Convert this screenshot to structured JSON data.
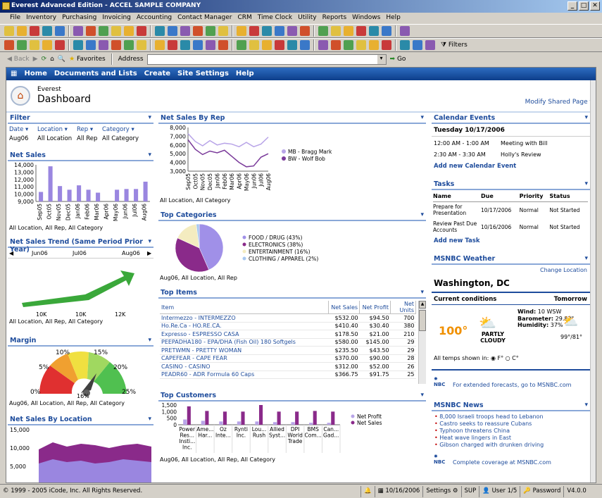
{
  "window": {
    "title": "Everest Advanced Edition - ACCEL SAMPLE COMPANY",
    "controls": [
      "_",
      "□",
      "✕"
    ]
  },
  "menu": [
    "File",
    "Inventory",
    "Purchasing",
    "Invoicing",
    "Accounting",
    "Contact Manager",
    "CRM",
    "Time Clock",
    "Utility",
    "Reports",
    "Windows",
    "Help"
  ],
  "nav": {
    "back": "Back",
    "favorites": "Favorites",
    "address_label": "Address",
    "go": "Go",
    "filters": "Filters"
  },
  "sp_nav": [
    "Home",
    "Documents and Lists",
    "Create",
    "Site Settings",
    "Help"
  ],
  "header": {
    "site": "Everest",
    "title": "Dashboard",
    "modify": "Modify Shared Page ▾"
  },
  "filter": {
    "title": "Filter",
    "cols": [
      "Date",
      "Location",
      "Rep",
      "Category"
    ],
    "vals": [
      "Aug06",
      "All Location",
      "All Rep",
      "All Category"
    ]
  },
  "net_sales": {
    "title": "Net Sales",
    "footer": "All Location, All Rep, All Category"
  },
  "net_sales_trend": {
    "title": "Net Sales Trend (Same Period Prior Year)",
    "months": [
      "Jun06",
      "Jul06",
      "Aug06"
    ],
    "ticks": [
      "10K",
      "10K",
      "12K"
    ],
    "footer": "All Location, All Rep, All Category"
  },
  "margin": {
    "title": "Margin",
    "labels": [
      "0%",
      "5%",
      "10%",
      "15%",
      "20%",
      "25%"
    ],
    "value": "16%",
    "footer": "Aug06, All Location, All Rep, All Category"
  },
  "net_sales_by_location": {
    "title": "Net Sales By Location",
    "yticks": [
      "15,000",
      "10,000",
      "5,000"
    ]
  },
  "net_sales_by_rep": {
    "title": "Net Sales By Rep",
    "legend": [
      "MB - Bragg Mark",
      "BW - Wolf Bob"
    ],
    "footer": "All Location, All Category"
  },
  "top_categories": {
    "title": "Top Categories",
    "footer": "Aug06, All Location, All Rep"
  },
  "top_items": {
    "title": "Top Items",
    "headers": [
      "Item",
      "Net Sales",
      "Net Profit",
      "Net Units"
    ],
    "rows": [
      [
        "Intermezzo - INTERMEZZO",
        "$532.00",
        "$94.50",
        "700"
      ],
      [
        "Ho.Re.Ca - HO.RE.CA.",
        "$410.40",
        "$30.40",
        "380"
      ],
      [
        "Expresso - ESPRESSO CASA",
        "$178.50",
        "$21.00",
        "210"
      ],
      [
        "PEEPADHA180 - EPA/DHA (Fish Oil) 180 Softgels",
        "$580.00",
        "$145.00",
        "29"
      ],
      [
        "PRETWMN - PRETTY WOMAN",
        "$235.50",
        "$43.50",
        "29"
      ],
      [
        "CAPEFEAR - CAPE FEAR",
        "$370.00",
        "$90.00",
        "28"
      ],
      [
        "CASINO - CASINO",
        "$312.00",
        "$52.00",
        "26"
      ],
      [
        "PEADR60 - ADR Formula 60 Caps",
        "$366.75",
        "$91.75",
        "25"
      ]
    ]
  },
  "top_customers": {
    "title": "Top Customers",
    "yticks": [
      "1,500",
      "1,000",
      "500",
      "0"
    ],
    "legend": [
      "Net Profit",
      "Net Sales"
    ],
    "customers": [
      "Power Res... Insti... Inc.",
      "Ame... Har...",
      "Oz Inte...",
      "Rynti Inc.",
      "Lou... Rush",
      "Allied Syst...",
      "DPI World Trade",
      "BMS Com...",
      "Can... Gad..."
    ],
    "footer": "Aug06, All Location, All Rep, All Category"
  },
  "calendar": {
    "title": "Calendar Events",
    "date": "Tuesday 10/17/2006",
    "events": [
      [
        "12:00 AM - 1:00 AM",
        "Meeting with Bill"
      ],
      [
        "2:30 AM - 3:30 AM",
        "Holly's Review"
      ]
    ],
    "add": "Add new Calendar Event"
  },
  "tasks": {
    "title": "Tasks",
    "headers": [
      "Name",
      "Due",
      "Priority",
      "Status"
    ],
    "rows": [
      [
        "Prepare for Presentation",
        "10/17/2006",
        "Normal",
        "Not Started"
      ],
      [
        "Review Past Due Accounts",
        "10/16/2006",
        "Normal",
        "Not Started"
      ]
    ],
    "add": "Add new Task"
  },
  "weather": {
    "title": "MSNBC Weather",
    "change": "Change Location",
    "city": "Washington, DC",
    "current": "Current conditions",
    "tomorrow": "Tomorrow",
    "temp": "100°",
    "cond": "PARTLY CLOUDY",
    "wind_label": "Wind:",
    "wind": "10 WSW",
    "baro_label": "Barometer:",
    "baro": "29.82\"",
    "hum_label": "Humidity:",
    "hum": "37%",
    "tom_temp": "99°/81°",
    "units_label": "All temps shown in:",
    "f": "F°",
    "c": "C°",
    "forecast": "For extended forecasts, go to MSNBC.com"
  },
  "news": {
    "title": "MSNBC News",
    "items": [
      "8,000 Israeli troops head to Lebanon",
      "Castro seeks to reassure Cubans",
      "Typhoon threatens China",
      "Heat wave lingers in East",
      "Gibson charged with drunken driving"
    ],
    "coverage": "Complete coverage at MSNBC.com"
  },
  "status": {
    "copyright": "© 1999 - 2005 iCode, Inc. All Rights Reserved.",
    "date": "10/16/2006",
    "settings": "Settings",
    "sup": "SUP",
    "user": "User 1/5",
    "password": "Password",
    "version": "V4.0.0"
  },
  "chart_data": [
    {
      "type": "bar",
      "title": "Net Sales",
      "categories": [
        "Sep05",
        "Oct05",
        "Nov05",
        "Dec05",
        "Jan06",
        "Feb06",
        "Mar06",
        "Apr06",
        "May06",
        "Jun06",
        "Jul06",
        "Aug06"
      ],
      "values": [
        10300,
        13800,
        11100,
        10600,
        11200,
        10600,
        10200,
        9000,
        10600,
        10700,
        10700,
        11700
      ],
      "ylim": [
        9000,
        14000
      ],
      "yticks": [
        "14,000",
        "13,000",
        "12,000",
        "11,000",
        "10,000",
        "9,000"
      ],
      "color": "#9a86e0"
    },
    {
      "type": "line",
      "title": "Net Sales By Rep",
      "categories": [
        "Sep05",
        "Oct05",
        "Nov05",
        "Dec05",
        "Jan06",
        "Feb06",
        "Mar06",
        "Apr06",
        "May06",
        "Jun06",
        "Jul06",
        "Aug06"
      ],
      "series": [
        {
          "name": "MB - Bragg Mark",
          "values": [
            7300,
            6400,
            5900,
            6500,
            6000,
            6200,
            6100,
            5800,
            6300,
            5800,
            6100,
            6900
          ],
          "color": "#b8a4e8"
        },
        {
          "name": "BW - Wolf Bob",
          "values": [
            6600,
            5500,
            4900,
            5300,
            5100,
            5400,
            4700,
            4000,
            3500,
            3600,
            4600,
            5000
          ],
          "color": "#7a3a9a"
        }
      ],
      "ylim": [
        3000,
        8000
      ],
      "yticks": [
        "8,000",
        "7,000",
        "6,000",
        "5,000",
        "4,000",
        "3,000"
      ]
    },
    {
      "type": "pie",
      "title": "Top Categories",
      "slices": [
        {
          "label": "FOOD / DRUG (43%)",
          "value": 43,
          "color": "#a090e8"
        },
        {
          "label": "ELECTRONICS (38%)",
          "value": 38,
          "color": "#8a2a8a"
        },
        {
          "label": "ENTERTAINMENT (16%)",
          "value": 16,
          "color": "#f4ecc0"
        },
        {
          "label": "CLOTHING / APPAREL (2%)",
          "value": 2,
          "color": "#a8c8f0"
        }
      ]
    },
    {
      "type": "bar",
      "title": "Top Customers",
      "ylim": [
        0,
        1500
      ],
      "series": [
        {
          "name": "Net Profit",
          "values": [
            400,
            300,
            250,
            250,
            250,
            200,
            200,
            150,
            150
          ],
          "color": "#b8a4e8"
        },
        {
          "name": "Net Sales",
          "values": [
            1400,
            1050,
            1000,
            1000,
            1500,
            1000,
            1000,
            1050,
            1000
          ],
          "color": "#8a2a8a"
        }
      ]
    }
  ]
}
